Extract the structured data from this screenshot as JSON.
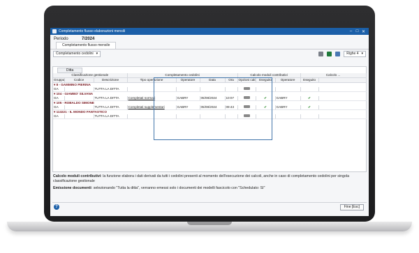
{
  "window": {
    "title": "Completamento flusso elaborazioni mensili"
  },
  "periodo": {
    "label": "Periodo",
    "value": "7/2024"
  },
  "tabs": [
    {
      "label": "Completamento flusso mensile"
    }
  ],
  "toolbar": {
    "select_value": "Completamento cedolini",
    "righe_label": "Righe 4"
  },
  "groupbar": {
    "chip": "Ditta"
  },
  "grid": {
    "super_headers": [
      "Classificazione gestionale",
      "Completamento cedolini",
      "Calcolo moduli contributivi",
      "Calcolo ..."
    ],
    "headers": [
      "Gruppo",
      "Codice",
      "Descrizione",
      "Tipo operazione",
      "Operatore",
      "Data",
      "Ora",
      "Opzioni calcolo",
      "Eseguito",
      "Operatore",
      "Eseguito"
    ],
    "rows": [
      {
        "group": "8 - GAMMINO PIERINA",
        "gruppo": "GA",
        "descrizione": "TUTTA LA DITTA",
        "tipo": "",
        "operatore": "",
        "data": "",
        "ora": "",
        "eseguito": "",
        "operatore2": "",
        "eseguito2": ""
      },
      {
        "group": "104 - GIAMBO' SILVANA",
        "gruppo": "GA",
        "descrizione": "TUTTA LA DITTA",
        "tipo": "Completati normali",
        "operatore": "GABRY",
        "data": "05/08/2024",
        "ora": "10:07",
        "eseguito": "✔",
        "operatore2": "GABRY",
        "eseguito2": "✔"
      },
      {
        "group": "105 - ROBALDO SIMONE",
        "gruppo": "GA",
        "descrizione": "TUTTA LA DITTA",
        "tipo": "Completati supplementari",
        "operatore": "GABRY",
        "data": "05/08/2024",
        "ora": "09:43",
        "eseguito": "✔",
        "operatore2": "GABRY",
        "eseguito2": "✔"
      },
      {
        "group": "113221 - IL MONDO FANTASTICO",
        "gruppo": "GA",
        "descrizione": "TUTTA LA DITTA",
        "tipo": "",
        "operatore": "",
        "data": "",
        "ora": "",
        "eseguito": "",
        "operatore2": "",
        "eseguito2": ""
      }
    ]
  },
  "notes": {
    "calcolo_title": "Calcolo moduli contributivi",
    "calcolo_text": ": la funzione elabora i dati derivati da tutti i cedolini presenti al momento dell'esecuzione dei calcoli, anche in caso di completamento cedolini per singola classificazione gestionale",
    "emissione_title": "Emissione documenti",
    "emissione_text": ": selezionando \"Tutta la ditta\", verranno emessi solo i documenti dei modelli fascicolo con \"Schedulato: SI\""
  },
  "footer": {
    "close_label": "Fine [Esc]"
  },
  "colors": {
    "titlebar": "#1b5fa8",
    "group_text": "#7b1a22",
    "check": "#2a8a2a"
  }
}
